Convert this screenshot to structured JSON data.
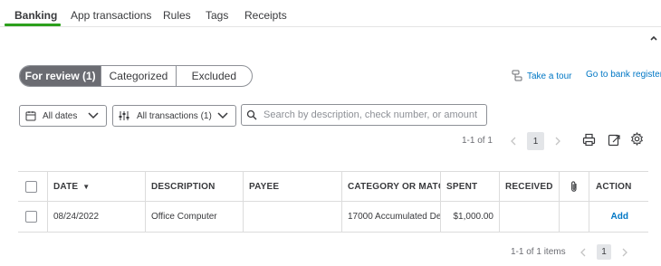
{
  "tabs": [
    {
      "label": "Banking",
      "active": true
    },
    {
      "label": "App transactions"
    },
    {
      "label": "Rules"
    },
    {
      "label": "Tags"
    },
    {
      "label": "Receipts"
    }
  ],
  "accent_color": "#2ca01c",
  "link_color": "#0077c5",
  "review_toggle": [
    {
      "label": "For review (1)",
      "active": true
    },
    {
      "label": "Categorized"
    },
    {
      "label": "Excluded"
    }
  ],
  "links": {
    "take_tour": "Take a tour",
    "bank_register": "Go to bank register"
  },
  "filters": {
    "dates": "All dates",
    "transactions": "All transactions (1)",
    "search_placeholder": "Search by description, check number, or amount"
  },
  "pager_top": {
    "range": "1-1 of 1",
    "page": "1"
  },
  "table": {
    "headers": [
      "DATE",
      "DESCRIPTION",
      "PAYEE",
      "CATEGORY OR MATCH",
      "SPENT",
      "RECEIVED",
      "ACTION"
    ],
    "sort_indicator": "▼",
    "rows": [
      {
        "date": "08/24/2022",
        "description": "Office Computer",
        "payee": "",
        "category": "17000 Accumulated De",
        "spent": "$1,000.00",
        "received": "",
        "action": "Add"
      }
    ]
  },
  "pager_bottom": {
    "range": "1-1 of 1 items",
    "page": "1"
  },
  "icons": [
    "chevron-up-icon",
    "tour-icon",
    "calendar-icon",
    "chevron-down-icon",
    "filter-sliders-icon",
    "search-icon",
    "chevron-left-icon",
    "chevron-right-icon",
    "print-icon",
    "export-icon",
    "gear-icon",
    "paperclip-icon"
  ]
}
